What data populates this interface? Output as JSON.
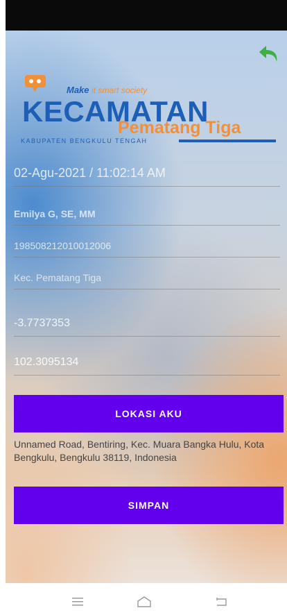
{
  "logo": {
    "tagline_part1": "Make",
    "tagline_part2": "it smart society",
    "brand_title": "KECAMATAN",
    "brand_subtitle": "Pematang Tiga",
    "brand_region": "KABUPATEN BENGKULU TENGAH"
  },
  "form": {
    "datetime": "02-Agu-2021 / 11:02:14 AM",
    "name": "Emilya G, SE, MM",
    "nip": "198508212010012006",
    "kecamatan": "Kec. Pematang Tiga",
    "latitude": "-3.7737353",
    "longitude": "102.3095134"
  },
  "buttons": {
    "lokasi_label": "LOKASI AKU",
    "simpan_label": "SIMPAN"
  },
  "address_text": "Unnamed Road, Bentiring, Kec. Muara Bangka Hulu, Kota Bengkulu, Bengkulu 38119, Indonesia",
  "icons": {
    "back": "undo-arrow-icon",
    "nav_menu": "menu-icon",
    "nav_home": "home-icon",
    "nav_back": "back-icon"
  },
  "colors": {
    "button": "#6200ee",
    "back_arrow": "#3cb043",
    "brand_blue": "#1d5fb5",
    "brand_orange": "#f0903a"
  }
}
